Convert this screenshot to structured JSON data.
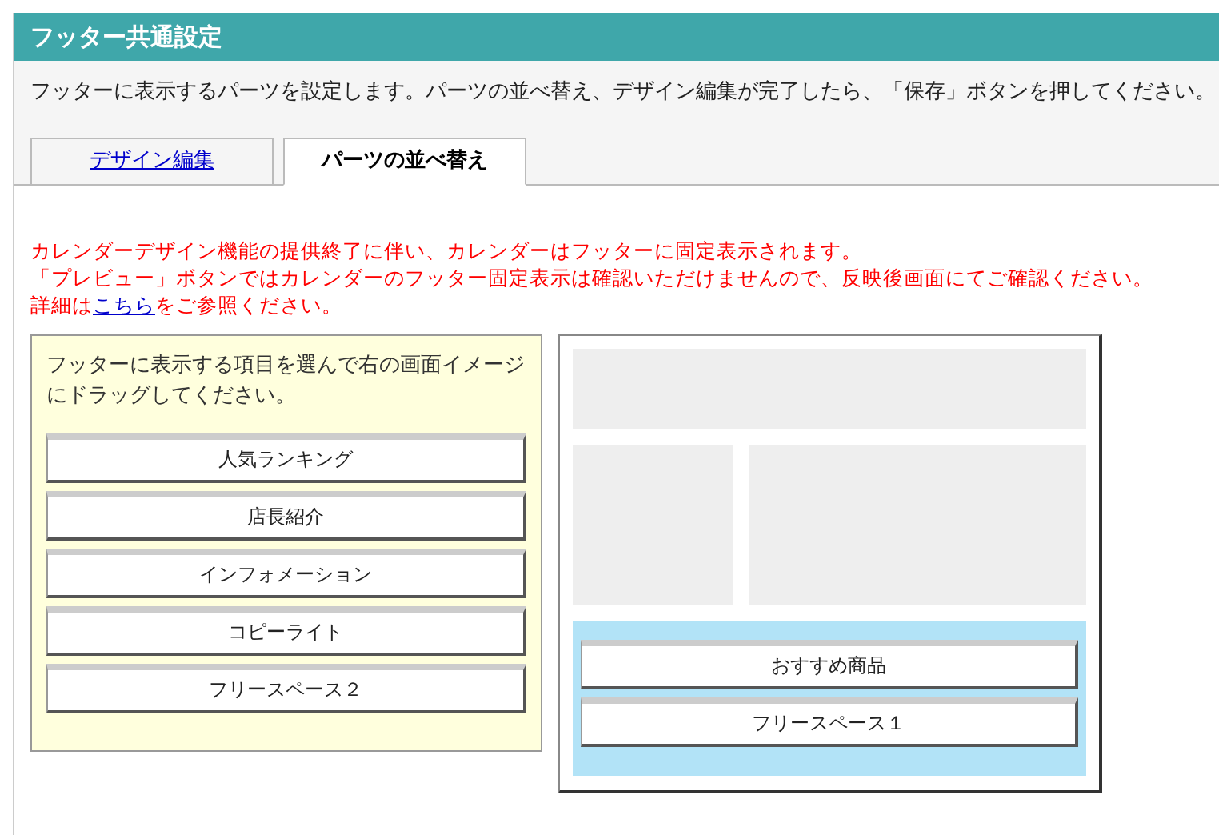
{
  "header": {
    "title": "フッター共通設定"
  },
  "description": "フッターに表示するパーツを設定します。パーツの並べ替え、デザイン編集が完了したら、「保存」ボタンを押してください。",
  "tabs": [
    {
      "label": "デザイン編集",
      "selected": false
    },
    {
      "label": "パーツの並べ替え",
      "selected": true
    }
  ],
  "notice": {
    "lines": [
      "カレンダーデザイン機能の提供終了に伴い、カレンダーはフッターに固定表示されます。",
      "「プレビュー」ボタンではカレンダーのフッター固定表示は確認いただけませんので、反映後画面にてご確認ください。"
    ],
    "detail_before": "詳細は",
    "detail_link": "こちら",
    "detail_after": "をご参照ください。"
  },
  "parts_panel": {
    "instruction": "フッターに表示する項目を選んで右の画面イメージにドラッグしてください。",
    "items": [
      "人気ランキング",
      "店長紹介",
      "インフォメーション",
      "コピーライト",
      "フリースペース２"
    ]
  },
  "preview": {
    "footer_items": [
      "おすすめ商品",
      "フリースペース１"
    ]
  }
}
